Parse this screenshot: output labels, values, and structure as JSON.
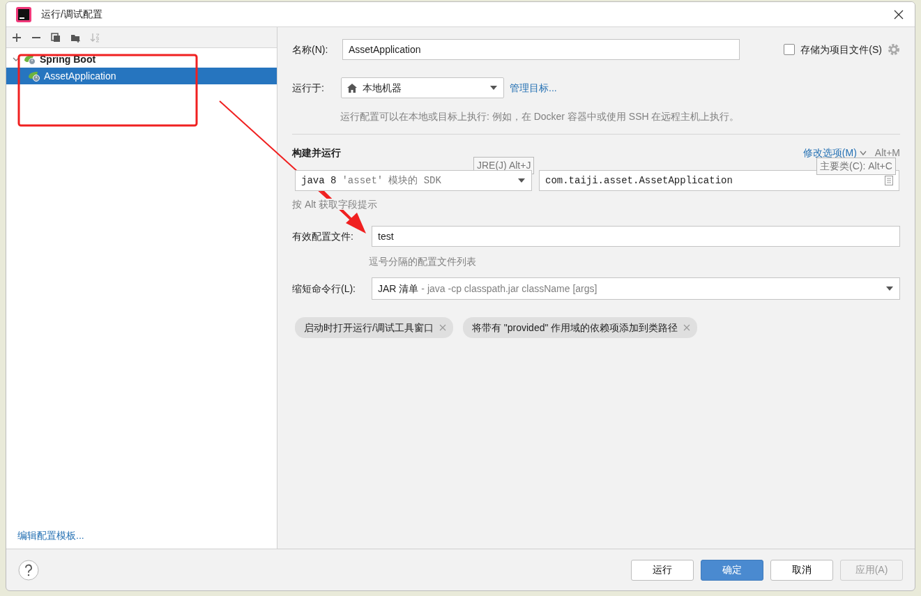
{
  "window": {
    "title": "运行/调试配置"
  },
  "toolbar": [
    {
      "kind": "add",
      "disabled": false
    },
    {
      "kind": "remove",
      "disabled": false
    },
    {
      "kind": "copy",
      "disabled": false
    },
    {
      "kind": "folder",
      "disabled": false
    },
    {
      "kind": "sort",
      "disabled": true
    }
  ],
  "tree": [
    {
      "label": "Spring Boot",
      "expanded": true,
      "selected": false,
      "children": [
        {
          "label": "AssetApplication",
          "selected": true
        }
      ]
    }
  ],
  "template_link": "编辑配置模板...",
  "form": {
    "name_label": "名称(N):",
    "name_value": "AssetApplication",
    "store_checkbox": {
      "label": "存储为项目文件(S)",
      "checked": false
    },
    "run_on_label": "运行于:",
    "run_on_value": "本地机器",
    "manage_link": "管理目标...",
    "run_on_hint": "运行配置可以在本地或目标上执行: 例如，在 Docker 容器中或使用 SSH 在远程主机上执行。",
    "section_title": "构建并运行",
    "modify_options": "修改选项(M)",
    "modify_shortcut": "Alt+M",
    "jre_value": "java 8",
    "jre_module": "'asset'",
    "jre_detail": "模块的 SDK",
    "main_class_value": "com.taiji.asset.AssetApplication",
    "alt_hint": "按 Alt 获取字段提示",
    "profiles_label": "有效配置文件:",
    "profiles_value": "test",
    "profiles_hint": "逗号分隔的配置文件列表",
    "shorten_label": "缩短命令行(L):",
    "shorten_value": "JAR 清单",
    "shorten_detail": "- java -cp classpath.jar className [args]",
    "chips": [
      {
        "label": "启动时打开运行/调试工具窗口"
      },
      {
        "label": "将带有 \"provided\" 作用域的依赖项添加到类路径"
      }
    ],
    "tooltips": [
      {
        "kind": "jre",
        "text": "JRE(J) Alt+J"
      },
      {
        "kind": "main_class",
        "text": "主要类(C): Alt+C"
      }
    ]
  },
  "buttons": [
    {
      "label": "运行",
      "kind": "default",
      "disabled": false
    },
    {
      "label": "确定",
      "kind": "primary",
      "disabled": false
    },
    {
      "label": "取消",
      "kind": "default",
      "disabled": false
    },
    {
      "label": "应用(A)",
      "kind": "default",
      "disabled": true
    }
  ],
  "annotations": {
    "highlight_box": true,
    "arrow": true
  }
}
